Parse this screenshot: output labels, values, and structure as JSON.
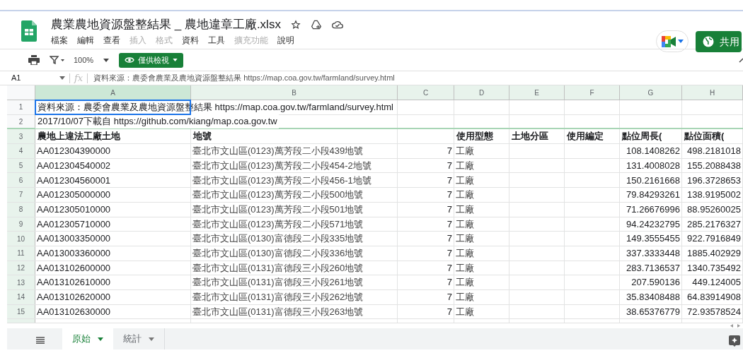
{
  "document": {
    "title": "農業農地資源盤整結果 _ 農地違章工廠.xlsx",
    "menu": [
      {
        "label": "檔案",
        "disabled": false
      },
      {
        "label": "編輯",
        "disabled": false
      },
      {
        "label": "查看",
        "disabled": false
      },
      {
        "label": "插入",
        "disabled": true
      },
      {
        "label": "格式",
        "disabled": true
      },
      {
        "label": "資料",
        "disabled": false
      },
      {
        "label": "工具",
        "disabled": false
      },
      {
        "label": "擴充功能",
        "disabled": true
      },
      {
        "label": "說明",
        "disabled": false
      }
    ]
  },
  "share_button": "共用",
  "toolbar": {
    "zoom": "100%",
    "mode": "僅供檢視"
  },
  "formula_bar": {
    "cell": "A1",
    "function_label": "fx",
    "content": "資料來源：農委會農業及農地資源盤整結果 https://map.coa.gov.tw/farmland/survey.html"
  },
  "columns": [
    {
      "label": "A",
      "selected": true,
      "numeric": false
    },
    {
      "label": "B",
      "selected": false,
      "numeric": false
    },
    {
      "label": "C",
      "selected": false,
      "numeric": true
    },
    {
      "label": "D",
      "selected": false,
      "numeric": false
    },
    {
      "label": "E",
      "selected": false
    },
    {
      "label": "F",
      "selected": false
    },
    {
      "label": "G",
      "selected": false,
      "numeric": true
    },
    {
      "label": "H",
      "selected": false,
      "numeric": true
    }
  ],
  "rows": [
    {
      "number": "1",
      "kind": "note",
      "frozen": true,
      "cells": {
        "A": "資料來源：農委會農業及農地資源盤整結果 https://map.coa.gov.tw/farmland/survey.html"
      }
    },
    {
      "number": "2",
      "kind": "note",
      "frozen": true,
      "cells": {
        "A": "2017/10/07下載自 https://github.com/kiang/map.coa.gov.tw"
      }
    },
    {
      "number": "3",
      "kind": "header",
      "frozen": false,
      "cells": {
        "A": "農地上違法工廠土地",
        "B": "地號",
        "D": "使用型態",
        "E": "土地分區",
        "F": "使用編定",
        "G": "點位周長(",
        "H": "點位面積("
      }
    },
    {
      "number": "4",
      "kind": "data",
      "frozen": false,
      "cells": {
        "A": "AA012304390000",
        "B": "臺北市文山區(0123)萬芳段二小段439地號",
        "C": "7",
        "D": "工廠",
        "G": "108.1408262",
        "H": "498.2181018"
      }
    },
    {
      "number": "5",
      "kind": "data",
      "frozen": false,
      "cells": {
        "A": "AA012304540002",
        "B": "臺北市文山區(0123)萬芳段二小段454-2地號",
        "C": "7",
        "D": "工廠",
        "G": "131.4008028",
        "H": "155.2088438"
      }
    },
    {
      "number": "6",
      "kind": "data",
      "frozen": false,
      "cells": {
        "A": "AA012304560001",
        "B": "臺北市文山區(0123)萬芳段二小段456-1地號",
        "C": "7",
        "D": "工廠",
        "G": "150.2161668",
        "H": "196.3728653"
      }
    },
    {
      "number": "7",
      "kind": "data",
      "frozen": false,
      "cells": {
        "A": "AA012305000000",
        "B": "臺北市文山區(0123)萬芳段二小段500地號",
        "C": "7",
        "D": "工廠",
        "G": "79.84293261",
        "H": "138.9195002"
      }
    },
    {
      "number": "8",
      "kind": "data",
      "frozen": false,
      "cells": {
        "A": "AA012305010000",
        "B": "臺北市文山區(0123)萬芳段二小段501地號",
        "C": "7",
        "D": "工廠",
        "G": "71.26676996",
        "H": "88.95260025"
      }
    },
    {
      "number": "9",
      "kind": "data",
      "frozen": false,
      "cells": {
        "A": "AA012305710000",
        "B": "臺北市文山區(0123)萬芳段二小段571地號",
        "C": "7",
        "D": "工廠",
        "G": "94.24232795",
        "H": "285.2176327"
      }
    },
    {
      "number": "10",
      "kind": "data",
      "frozen": false,
      "cells": {
        "A": "AA013003350000",
        "B": "臺北市文山區(0130)富德段二小段335地號",
        "C": "7",
        "D": "工廠",
        "G": "149.3555455",
        "H": "922.7916849"
      }
    },
    {
      "number": "11",
      "kind": "data",
      "frozen": false,
      "cells": {
        "A": "AA013003360000",
        "B": "臺北市文山區(0130)富德段二小段336地號",
        "C": "7",
        "D": "工廠",
        "G": "337.3333448",
        "H": "1885.402929"
      }
    },
    {
      "number": "12",
      "kind": "data",
      "frozen": false,
      "cells": {
        "A": "AA013102600000",
        "B": "臺北市文山區(0131)富德段三小段260地號",
        "C": "7",
        "D": "工廠",
        "G": "283.7136537",
        "H": "1340.735492"
      }
    },
    {
      "number": "13",
      "kind": "data",
      "frozen": false,
      "cells": {
        "A": "AA013102610000",
        "B": "臺北市文山區(0131)富德段三小段261地號",
        "C": "7",
        "D": "工廠",
        "G": "207.590136",
        "H": "449.124005"
      }
    },
    {
      "number": "14",
      "kind": "data",
      "frozen": false,
      "cells": {
        "A": "AA013102620000",
        "B": "臺北市文山區(0131)富德段三小段262地號",
        "C": "7",
        "D": "工廠",
        "G": "35.83408488",
        "H": "64.83914908"
      }
    },
    {
      "number": "15",
      "kind": "data",
      "frozen": false,
      "cells": {
        "A": "AA013102630000",
        "B": "臺北市文山區(0131)富德段三小段263地號",
        "C": "7",
        "D": "工廠",
        "G": "38.65376779",
        "H": "72.93578524"
      }
    }
  ],
  "sheet_tabs": [
    {
      "label": "原始",
      "selected": true
    },
    {
      "label": "統計",
      "selected": false
    }
  ]
}
